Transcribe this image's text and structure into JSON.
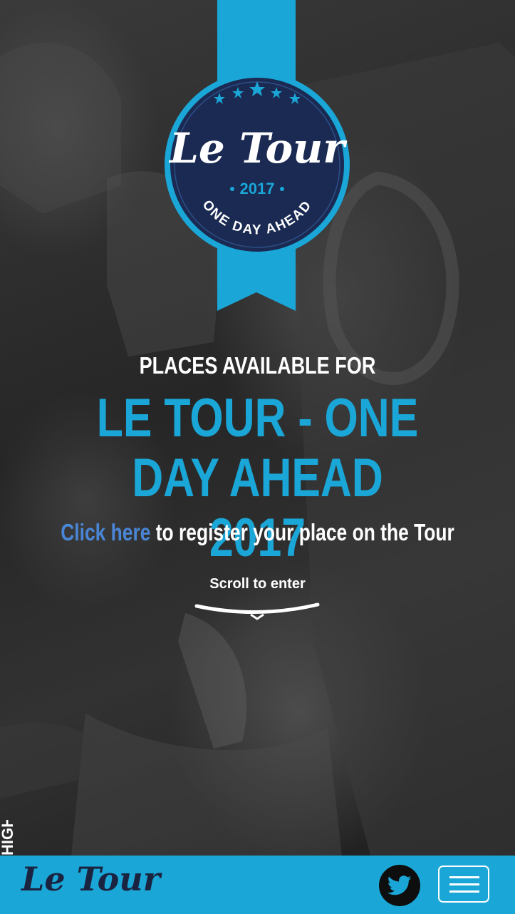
{
  "badge": {
    "brand_text": "Le Tour",
    "year": "2017",
    "tagline": "ONE DAY AHEAD"
  },
  "hero": {
    "headline_small": "PLACES AVAILABLE FOR",
    "headline_big": "LE TOUR - ONE DAY AHEAD 2017",
    "register_link": "Click here",
    "register_rest": " to register your place on the Tour",
    "scroll_label": "Scroll to enter"
  },
  "side_tab": {
    "label": "HIGH"
  },
  "footer": {
    "logo_text": "Le Tour"
  },
  "colors": {
    "accent_blue": "#1aa6d6",
    "badge_navy": "#1a2a52",
    "link_blue": "#4a86d6",
    "footer_bg": "#1aa6d6"
  },
  "icons": {
    "twitter": "twitter-bird-icon",
    "menu": "hamburger-menu-icon",
    "scroll": "chevron-down-icon"
  }
}
